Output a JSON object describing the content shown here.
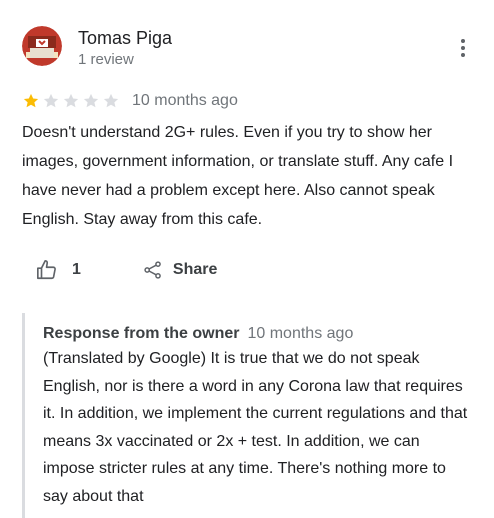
{
  "review": {
    "author": "Tomas Piga",
    "review_count": "1 review",
    "rating": 1,
    "rating_max": 5,
    "time": "10 months ago",
    "text": "Doesn't understand 2G+ rules. Even if you try to show her images, government information, or translate stuff. Any cafe I have never had a problem except here. Also cannot speak English. Stay away from this cafe.",
    "likes": "1",
    "share_label": "Share",
    "star_color_filled": "#fbbc04",
    "star_color_empty": "#dadce0"
  },
  "owner_response": {
    "title": "Response from the owner",
    "time": "10 months ago",
    "text": "(Translated by Google) It is true that we do not speak English, nor is there a word in any Corona law that requires it. In addition, we implement the current regulations and that means 3x vaccinated or 2x + test. In addition, we can impose stricter rules at any time. There's nothing more to say about that"
  },
  "icons": {
    "more": "more-vert-icon",
    "like": "thumb-up-icon",
    "share": "share-icon",
    "star": "star-icon"
  }
}
